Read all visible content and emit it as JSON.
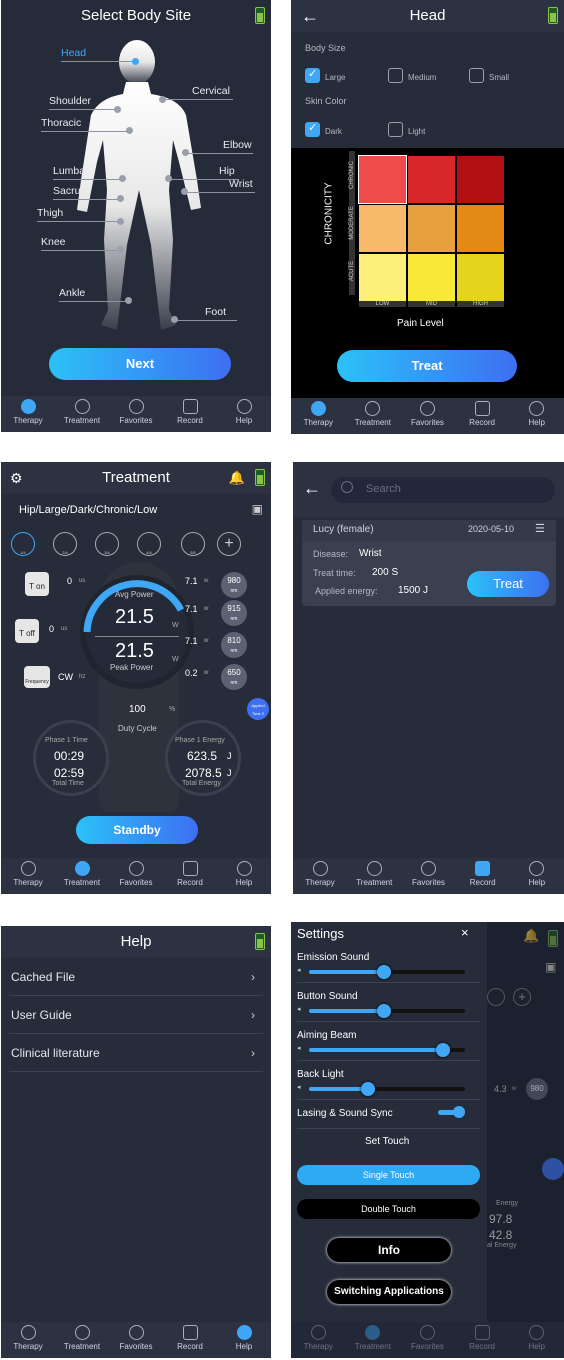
{
  "tabs": [
    "Therapy",
    "Treatment",
    "Favorites",
    "Record",
    "Help"
  ],
  "screen1": {
    "title": "Select Body Site",
    "sites": {
      "head": "Head",
      "shoulder": "Shoulder",
      "thoracic": "Thoracic",
      "cervical": "Cervical",
      "elbow": "Elbow",
      "lumbar": "Lumbar",
      "hip": "Hip",
      "sacrum": "Sacrum",
      "wrist": "Wrist",
      "thigh": "Thigh",
      "knee": "Knee",
      "ankle": "Ankle",
      "foot": "Foot"
    },
    "next_label": "Next"
  },
  "screen2": {
    "title": "Head",
    "body_size_label": "Body Size",
    "body_sizes": [
      "Large",
      "Medium",
      "Small"
    ],
    "skin_color_label": "Skin Color",
    "skin_colors": [
      "Dark",
      "Light"
    ],
    "chronicity_label": "CHRONICITY",
    "rows": [
      "CHRONIC",
      "MODERATE",
      "ACUTE"
    ],
    "cols": [
      "LOW",
      "MID",
      "HIGH"
    ],
    "pain_label": "Pain Level",
    "colors": [
      "#ef4b4b",
      "#d8272a",
      "#b10f12",
      "#f6ba6a",
      "#e7a23d",
      "#e58915",
      "#fdf07a",
      "#f8e83a",
      "#e5d41c"
    ],
    "treat_label": "Treat"
  },
  "screen3": {
    "title": "Treatment",
    "path": "Hip/Large/Dark/Chronic/Low",
    "t_on": "T on",
    "t_on_val": "0",
    "t_on_unit": "us",
    "t_off": "T off",
    "t_off_val": "0",
    "t_off_unit": "us",
    "freq": "Frequency",
    "freq_val": "CW",
    "freq_unit": "hz",
    "avg_power_label": "Avg Power",
    "avg_power": "21.5",
    "w": "W",
    "peak_power_label": "Peak Power",
    "peak_power": "21.5",
    "wl": [
      {
        "w": "7.1",
        "nm": "980"
      },
      {
        "w": "7.1",
        "nm": "915"
      },
      {
        "w": "7.1",
        "nm": "810"
      },
      {
        "w": "0.2",
        "nm": "650"
      }
    ],
    "w_unit": "w",
    "nm_unit": "nm",
    "duty": "100",
    "duty_unit": "%",
    "duty_label": "Duty Cycle",
    "phase_time_label": "Phase 1 Time",
    "phase_time": "00:29",
    "total_time": "02:59",
    "total_time_label": "Total Time",
    "phase_energy_label": "Phase 1 Energy",
    "phase_energy": "623.5",
    "total_energy": "2078.5",
    "j": "J",
    "total_energy_label": "Total Energy",
    "standby_label": "Standby",
    "applied_badge": "Applied Tone 2",
    "wave_labels": [
      "1/4",
      "2/4",
      "3/4",
      "4/4",
      "5/5"
    ]
  },
  "screen4": {
    "search_placeholder": "Search",
    "name": "Lucy (female)",
    "date": "2020-05-10",
    "disease_label": "Disease:",
    "disease": "Wrist",
    "time_label": "Treat time:",
    "time": "200 S",
    "energy_label": "Applied energy:",
    "energy": "1500 J",
    "treat_label": "Treat"
  },
  "screen5": {
    "title": "Help",
    "items": [
      "Cached File",
      "User Guide",
      "Clinical literature"
    ]
  },
  "screen6": {
    "title": "Settings",
    "sliders": [
      {
        "label": "Emission Sound",
        "v": 0.48
      },
      {
        "label": "Button Sound",
        "v": 0.48
      },
      {
        "label": "Aiming Beam",
        "v": 0.86
      },
      {
        "label": "Back Light",
        "v": 0.38
      }
    ],
    "sync_label": "Lasing & Sound Sync",
    "set_touch": "Set Touch",
    "single": "Single Touch",
    "double": "Double Touch",
    "info": "Info",
    "switching": "Switching Applications",
    "bg_w": "4.3",
    "bg_w_unit": "w",
    "bg_nm": "980",
    "bg_energy": "Energy",
    "bg_e1": "97.8",
    "bg_e2": "42.8",
    "bg_e_label": "al Energy"
  }
}
